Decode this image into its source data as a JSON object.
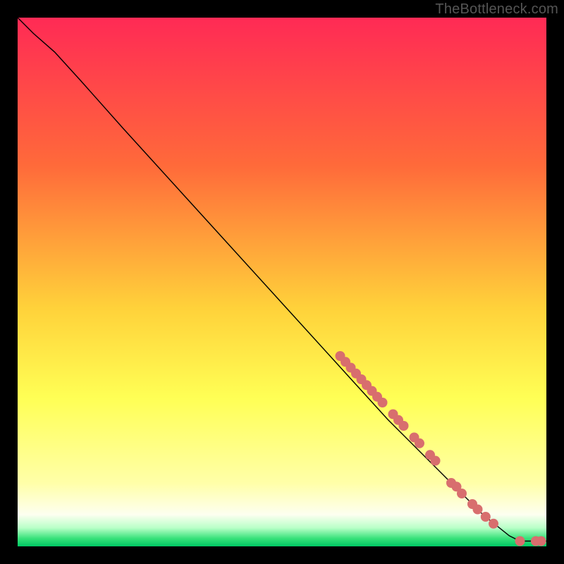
{
  "watermark": "TheBottleneck.com",
  "colors": {
    "curve": "#000000",
    "marker_fill": "#d86e6e",
    "marker_stroke": "#c05a5a",
    "frame_bg": "#000000"
  },
  "chart_data": {
    "type": "line",
    "title": "",
    "xlabel": "",
    "ylabel": "",
    "xlim": [
      0,
      100
    ],
    "ylim": [
      0,
      100
    ],
    "gradient_stops": [
      {
        "offset": 0.0,
        "color": "#ff2a55"
      },
      {
        "offset": 0.28,
        "color": "#ff6a3a"
      },
      {
        "offset": 0.55,
        "color": "#ffd23a"
      },
      {
        "offset": 0.72,
        "color": "#ffff55"
      },
      {
        "offset": 0.88,
        "color": "#ffffa8"
      },
      {
        "offset": 0.94,
        "color": "#fdfff0"
      },
      {
        "offset": 0.965,
        "color": "#b9ffc8"
      },
      {
        "offset": 0.985,
        "color": "#38e27a"
      },
      {
        "offset": 1.0,
        "color": "#00c864"
      }
    ],
    "curve": [
      {
        "x": 0,
        "y": 100
      },
      {
        "x": 3,
        "y": 97
      },
      {
        "x": 7,
        "y": 93.5
      },
      {
        "x": 12,
        "y": 88
      },
      {
        "x": 20,
        "y": 79
      },
      {
        "x": 30,
        "y": 68
      },
      {
        "x": 40,
        "y": 57
      },
      {
        "x": 50,
        "y": 46
      },
      {
        "x": 60,
        "y": 35
      },
      {
        "x": 70,
        "y": 24
      },
      {
        "x": 80,
        "y": 14
      },
      {
        "x": 88,
        "y": 6
      },
      {
        "x": 93,
        "y": 2
      },
      {
        "x": 95,
        "y": 1
      },
      {
        "x": 97,
        "y": 1
      },
      {
        "x": 100,
        "y": 1
      }
    ],
    "markers": [
      {
        "x": 61,
        "y": 36.0
      },
      {
        "x": 62,
        "y": 34.9
      },
      {
        "x": 63,
        "y": 33.8
      },
      {
        "x": 64,
        "y": 32.7
      },
      {
        "x": 65,
        "y": 31.6
      },
      {
        "x": 66,
        "y": 30.5
      },
      {
        "x": 67,
        "y": 29.4
      },
      {
        "x": 68,
        "y": 28.3
      },
      {
        "x": 69,
        "y": 27.2
      },
      {
        "x": 71,
        "y": 25.0
      },
      {
        "x": 72,
        "y": 23.9
      },
      {
        "x": 73,
        "y": 22.8
      },
      {
        "x": 75,
        "y": 20.6
      },
      {
        "x": 76,
        "y": 19.5
      },
      {
        "x": 78,
        "y": 17.3
      },
      {
        "x": 79,
        "y": 16.2
      },
      {
        "x": 82,
        "y": 12.0
      },
      {
        "x": 83,
        "y": 11.3
      },
      {
        "x": 84,
        "y": 10.0
      },
      {
        "x": 86,
        "y": 8.0
      },
      {
        "x": 87,
        "y": 7.0
      },
      {
        "x": 88.5,
        "y": 5.6
      },
      {
        "x": 90,
        "y": 4.3
      },
      {
        "x": 95,
        "y": 1.0
      },
      {
        "x": 98,
        "y": 1.0
      },
      {
        "x": 99,
        "y": 1.0
      }
    ]
  }
}
